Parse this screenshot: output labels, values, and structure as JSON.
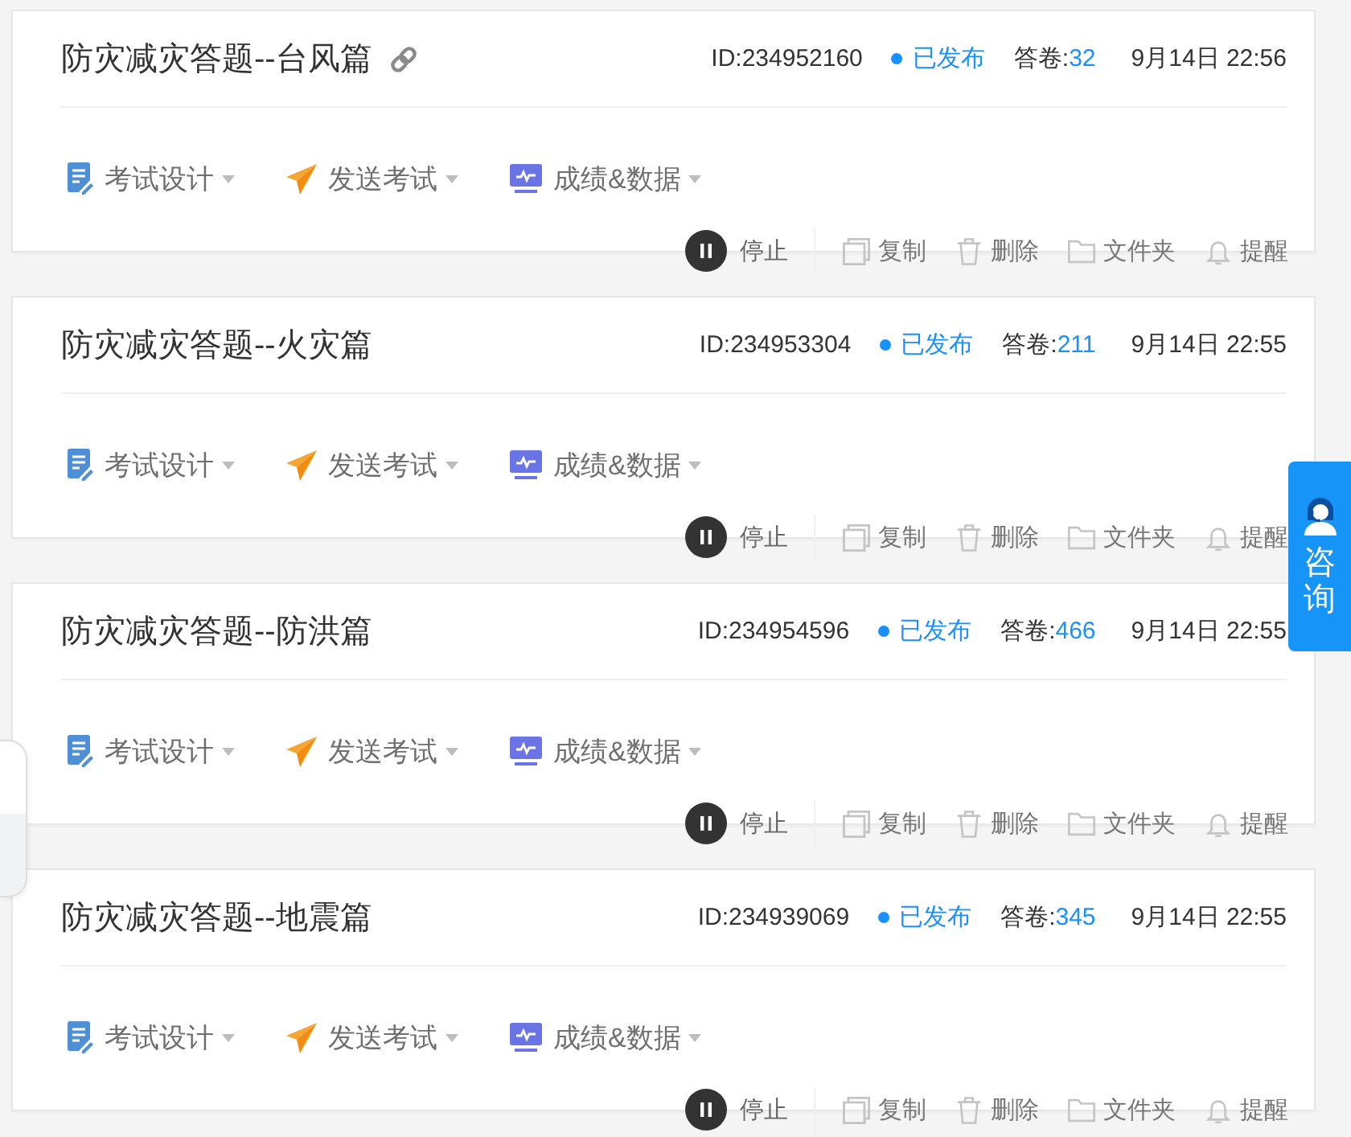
{
  "exams": [
    {
      "title": "防灾减灾答题--台风篇",
      "link_icon": true,
      "id": "ID:234952160",
      "status": "已发布",
      "responses_label": "答卷:",
      "responses": "32",
      "date": "9月14日 22:56",
      "menus": [
        {
          "kind": "design",
          "label": "考试设计"
        },
        {
          "kind": "send",
          "label": "发送考试"
        },
        {
          "kind": "results",
          "label": "成绩&数据"
        }
      ],
      "actions": [
        {
          "kind": "stop",
          "label": "停止"
        },
        {
          "kind": "copy",
          "label": "复制"
        },
        {
          "kind": "delete",
          "label": "删除"
        },
        {
          "kind": "folder",
          "label": "文件夹"
        },
        {
          "kind": "remind",
          "label": "提醒"
        }
      ]
    },
    {
      "title": "防灾减灾答题--火灾篇",
      "link_icon": false,
      "id": "ID:234953304",
      "status": "已发布",
      "responses_label": "答卷:",
      "responses": "211",
      "date": "9月14日 22:55",
      "menus": [
        {
          "kind": "design",
          "label": "考试设计"
        },
        {
          "kind": "send",
          "label": "发送考试"
        },
        {
          "kind": "results",
          "label": "成绩&数据"
        }
      ],
      "actions": [
        {
          "kind": "stop",
          "label": "停止"
        },
        {
          "kind": "copy",
          "label": "复制"
        },
        {
          "kind": "delete",
          "label": "删除"
        },
        {
          "kind": "folder",
          "label": "文件夹"
        },
        {
          "kind": "remind",
          "label": "提醒"
        }
      ]
    },
    {
      "title": "防灾减灾答题--防洪篇",
      "link_icon": false,
      "id": "ID:234954596",
      "status": "已发布",
      "responses_label": "答卷:",
      "responses": "466",
      "date": "9月14日 22:55",
      "menus": [
        {
          "kind": "design",
          "label": "考试设计"
        },
        {
          "kind": "send",
          "label": "发送考试"
        },
        {
          "kind": "results",
          "label": "成绩&数据"
        }
      ],
      "actions": [
        {
          "kind": "stop",
          "label": "停止"
        },
        {
          "kind": "copy",
          "label": "复制"
        },
        {
          "kind": "delete",
          "label": "删除"
        },
        {
          "kind": "folder",
          "label": "文件夹"
        },
        {
          "kind": "remind",
          "label": "提醒"
        }
      ]
    },
    {
      "title": "防灾减灾答题--地震篇",
      "link_icon": false,
      "id": "ID:234939069",
      "status": "已发布",
      "responses_label": "答卷:",
      "responses": "345",
      "date": "9月14日 22:55",
      "menus": [
        {
          "kind": "design",
          "label": "考试设计"
        },
        {
          "kind": "send",
          "label": "发送考试"
        },
        {
          "kind": "results",
          "label": "成绩&数据"
        }
      ],
      "actions": [
        {
          "kind": "stop",
          "label": "停止"
        },
        {
          "kind": "copy",
          "label": "复制"
        },
        {
          "kind": "delete",
          "label": "删除"
        },
        {
          "kind": "folder",
          "label": "文件夹"
        },
        {
          "kind": "remind",
          "label": "提醒"
        }
      ]
    }
  ],
  "consult": {
    "label": "咨询"
  }
}
